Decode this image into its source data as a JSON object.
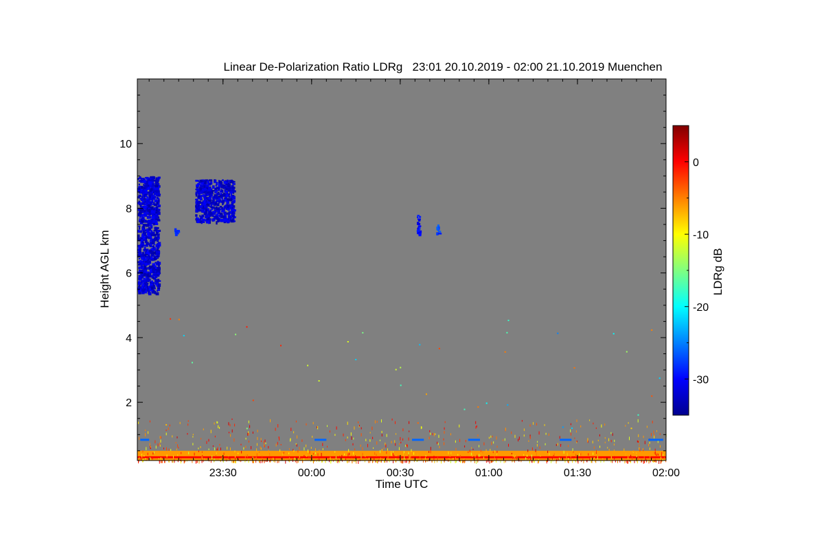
{
  "chart_data": {
    "type": "heatmap",
    "title": "Linear De-Polarization Ratio LDRg   23:01 20.10.2019 - 02:00 21.10.2019 Muenchen",
    "xlabel": "Time UTC",
    "ylabel": "Height AGL km",
    "x_range_utc": [
      "23:01",
      "02:00"
    ],
    "x_tick_labels": [
      "23:30",
      "00:00",
      "00:30",
      "01:00",
      "01:30",
      "02:00"
    ],
    "x_tick_minutes_after_2301": [
      29,
      59,
      89,
      119,
      149,
      179
    ],
    "ylim": [
      0.2,
      12.0
    ],
    "y_ticks": [
      2,
      4,
      6,
      8,
      10
    ],
    "background_color": "#808080",
    "colorbar": {
      "label": "LDRg dB",
      "range": [
        -35,
        5
      ],
      "ticks": [
        0,
        -10,
        -20,
        -30
      ],
      "colors": [
        "#00008f",
        "#0000ff",
        "#0080ff",
        "#00ffff",
        "#80ff80",
        "#ffff00",
        "#ff8000",
        "#ff0000",
        "#800000"
      ]
    },
    "features": [
      {
        "name": "ice cloud column",
        "t_start": 0,
        "t_end": 7,
        "h_bottom": 5.4,
        "h_top": 9.0,
        "ldr_db": -32
      },
      {
        "name": "ice cloud patch",
        "t_start": 19.5,
        "t_end": 32.5,
        "h_bottom": 7.6,
        "h_top": 8.9,
        "ldr_db": -32
      },
      {
        "name": "small echo",
        "t_start": 12.5,
        "t_end": 14,
        "h_bottom": 7.2,
        "h_top": 7.4,
        "ldr_db": -28
      },
      {
        "name": "small echo",
        "t_start": 94.5,
        "t_end": 95.5,
        "h_bottom": 7.2,
        "h_top": 7.8,
        "ldr_db": -30
      },
      {
        "name": "small echo",
        "t_start": 101,
        "t_end": 102,
        "h_bottom": 7.2,
        "h_top": 7.5,
        "ldr_db": -28
      }
    ],
    "surface_layer": {
      "h_bottom": 0.2,
      "h_top": 0.5,
      "ldr_db": [
        -8,
        0
      ]
    },
    "horizontal_streaks_km": 0.85
  }
}
